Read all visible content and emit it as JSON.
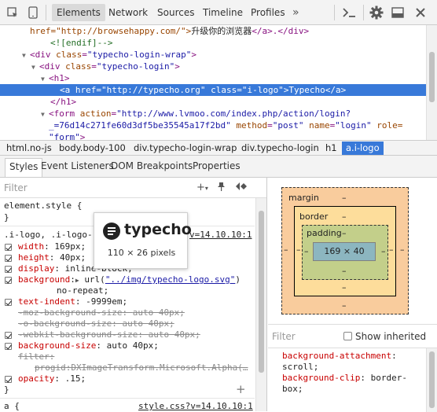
{
  "toolbar": {
    "tabs": [
      {
        "label": "Elements",
        "active": true
      },
      {
        "label": "Network"
      },
      {
        "label": "Sources"
      },
      {
        "label": "Timeline"
      },
      {
        "label": "Profiles"
      }
    ],
    "more": "»",
    "icons": [
      "inspect-icon",
      "device-icon",
      "console-drawer-icon",
      "settings-icon",
      "dock-icon",
      "close-icon"
    ]
  },
  "dom": {
    "lines": [
      {
        "pre": "href=\"http://browsehappy.com/\">",
        "text": "升级你的浏览器",
        "post": "</a>.</div>"
      },
      {
        "comment": "<![endif]-->"
      },
      {
        "open": "<div",
        "attr": "class",
        "val": "\"typecho-login-wrap\"",
        "close": ">"
      },
      {
        "open": "<div",
        "attr": "class",
        "val": "\"typecho-login\"",
        "close": ">"
      },
      {
        "open": "<h1>"
      },
      {
        "open": "<a",
        "attr1": "href",
        "val1": "\"http://typecho.org\"",
        "attr2": "class",
        "val2": "\"i-logo\"",
        "mid": ">Typecho</a>"
      },
      {
        "open": "</h1>"
      },
      {
        "open": "<form",
        "attr1": "action",
        "val1": "\"http://www.lvmoo.com/index.php/action/login?"
      },
      {
        "val1": "_=76d14c271fe60d3df5be35545a17f2bd\"",
        "attr2": "method",
        "val2": "\"post\"",
        "attr3": "name",
        "val3": "\"login\"",
        "attr4": "role="
      },
      {
        "val1": "\"form\"",
        "close": ">"
      }
    ]
  },
  "breadcrumbs": [
    "html.no-js",
    "body.body-100",
    "div.typecho-login-wrap",
    "div.typecho-login",
    "h1",
    "a.i-logo"
  ],
  "subtabs": [
    "Styles",
    "Event Listeners",
    "DOM Breakpoints",
    "Properties"
  ],
  "styles": {
    "filter_placeholder": "Filter",
    "element_style": "element.style {",
    "close_brace": "}",
    "rule_selector": ".i-logo, .i-logo-",
    "rule_source": "v=14.10.10:1",
    "props": [
      {
        "name": "width",
        "value": "169px;",
        "checked": true
      },
      {
        "name": "height",
        "value": "40px;",
        "checked": true
      },
      {
        "name": "display",
        "value": "inline-block;",
        "checked": true
      },
      {
        "name": "background",
        "value": "url(",
        "link": "\"../img/typecho-logo.svg\"",
        "after": ")",
        "checked": true
      },
      {
        "continuation": "no-repeat;"
      },
      {
        "name": "text-indent",
        "value": "-9999em;",
        "checked": true
      },
      {
        "name": "-moz-background-size",
        "value": "auto 40px;",
        "struck": true
      },
      {
        "name": "-o-background-size",
        "value": "auto 40px;",
        "struck": true
      },
      {
        "name": "-webkit-background-size",
        "value": "auto 40px;",
        "struck": true,
        "checked": true
      },
      {
        "name": "background-size",
        "value": "auto 40px;",
        "checked": true
      },
      {
        "name": "filter",
        "value": "",
        "struck": true
      },
      {
        "continuation": "progid:DXImageTransform.Microsoft.Alpha(…"
      },
      {
        "name": "opacity",
        "value": ".15;",
        "checked": true
      }
    ],
    "next_selector": "a {",
    "next_source": "style.css?v=14.10.10:1",
    "add_button": "+"
  },
  "tooltip": {
    "logo_text": "typecho",
    "dims": "110 × 26 pixels"
  },
  "box_model": {
    "margin_label": "margin",
    "border_label": "border",
    "padding_label": "padding",
    "content": "169 × 40",
    "dash": "–"
  },
  "computed": {
    "filter_placeholder": "Filter",
    "show_inherited": "Show inherited",
    "lines": [
      {
        "name": "background-attachment",
        "value": ""
      },
      {
        "value": "scroll;"
      },
      {
        "name": "background-clip",
        "value": "border-"
      },
      {
        "value": "box;"
      }
    ]
  }
}
